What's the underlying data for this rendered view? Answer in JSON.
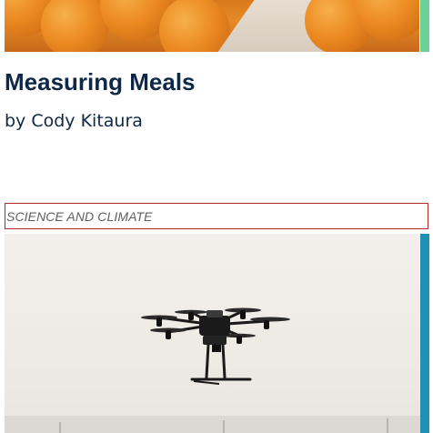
{
  "article": {
    "title": "Measuring Meals",
    "byline": "by Cody Kitaura"
  },
  "category": {
    "label": "SCIENCE AND CLIMATE"
  },
  "colors": {
    "title_text": "#0f2847",
    "category_border": "#b02a2a",
    "top_accent": "#6bd19a",
    "drone_accent": "#1f8fb3"
  },
  "images": {
    "top": "oranges-photo",
    "bottom": "drone-photo"
  }
}
